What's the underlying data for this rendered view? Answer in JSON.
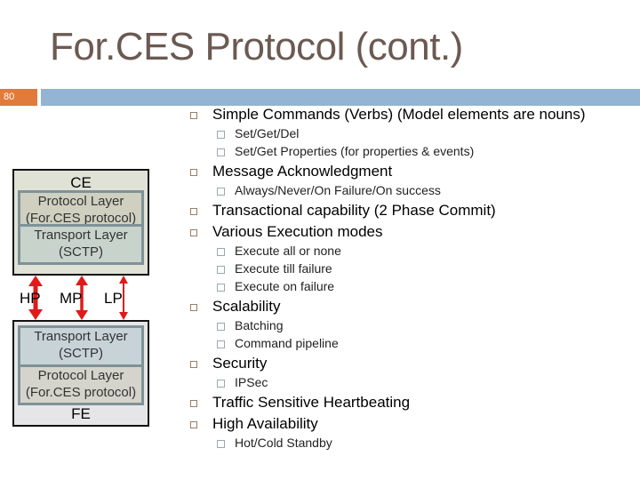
{
  "title": "For.CES Protocol (cont.)",
  "slide_number": "80",
  "colors": {
    "title": "#6b5a52",
    "slide_number_bg": "#e07b3c",
    "band": "#93b4d2",
    "arrow": "#e01a1a"
  },
  "diagram": {
    "ce": {
      "label": "CE",
      "protocol_layer": "Protocol Layer (For.CES protocol)",
      "transport_layer": "Transport Layer (SCTP)"
    },
    "fe": {
      "label": "FE",
      "transport_layer": "Transport Layer (SCTP)",
      "protocol_layer": "Protocol Layer (For.CES protocol)"
    },
    "priorities": [
      "HP",
      "MP",
      "LP"
    ]
  },
  "bullets": [
    {
      "text": "Simple Commands (Verbs) (Model elements are nouns)",
      "subs": [
        "Set/Get/Del",
        "Set/Get Properties (for properties & events)"
      ]
    },
    {
      "text": "Message Acknowledgment",
      "subs": [
        "Always/Never/On Failure/On success"
      ]
    },
    {
      "text": "Transactional capability (2 Phase Commit)",
      "subs": []
    },
    {
      "text": "Various Execution modes",
      "subs": [
        "Execute all or none",
        "Execute till failure",
        "Execute on failure"
      ]
    },
    {
      "text": "Scalability",
      "subs": [
        "Batching",
        "Command pipeline"
      ]
    },
    {
      "text": "Security",
      "subs": [
        "IPSec"
      ]
    },
    {
      "text": "Traffic Sensitive Heartbeating",
      "subs": []
    },
    {
      "text": "High Availability",
      "subs": [
        "Hot/Cold Standby"
      ]
    }
  ]
}
